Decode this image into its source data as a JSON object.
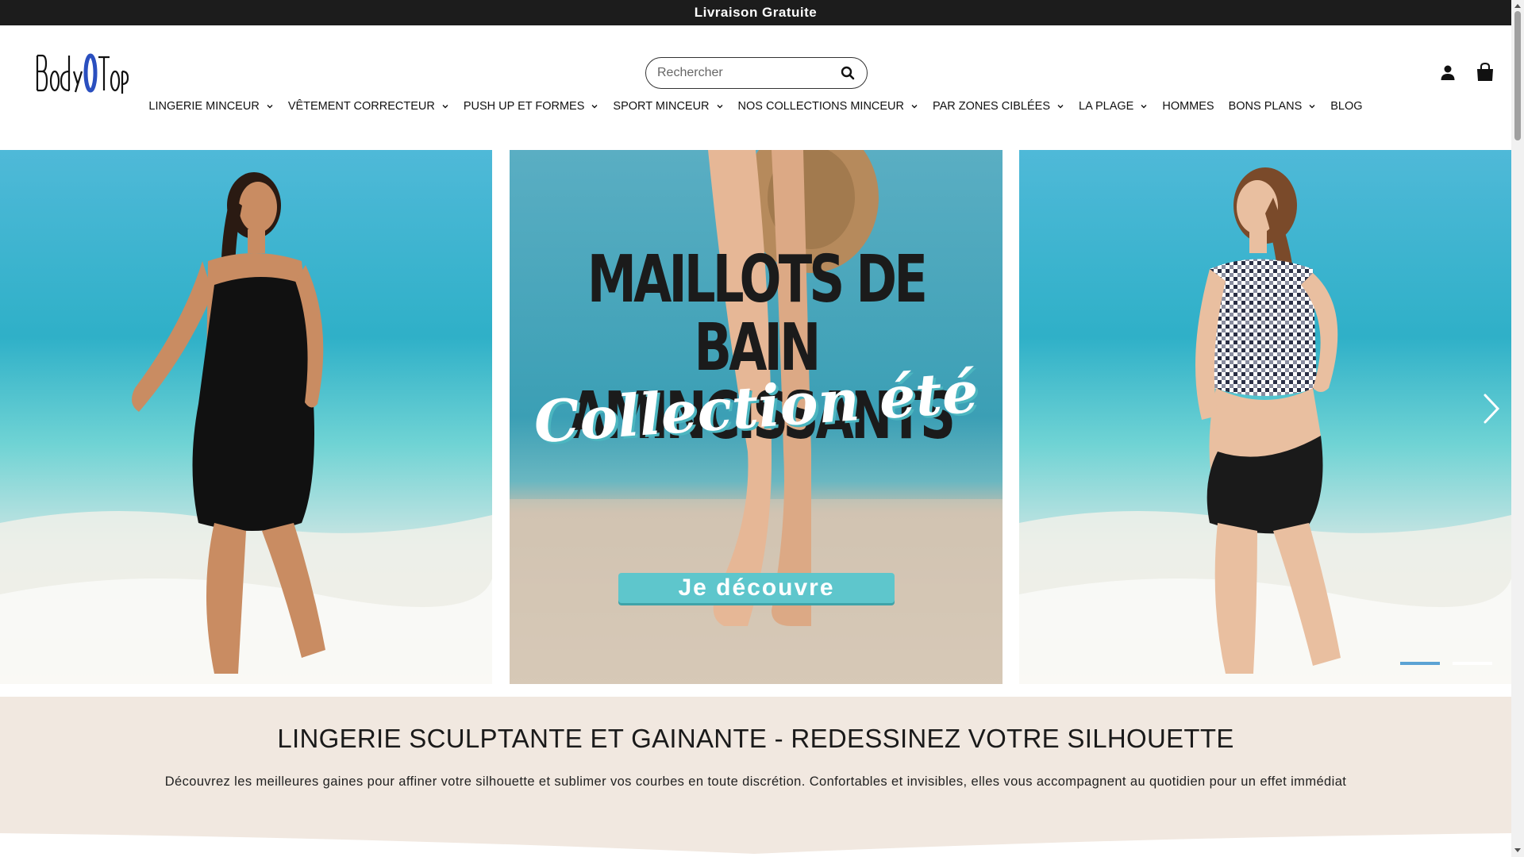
{
  "announcement": "Livraison Gratuite",
  "brand": "BodyOTop",
  "search": {
    "placeholder": "Rechercher"
  },
  "nav": [
    {
      "label": "LINGERIE MINCEUR",
      "dropdown": true
    },
    {
      "label": "VÊTEMENT CORRECTEUR",
      "dropdown": true
    },
    {
      "label": "PUSH UP ET FORMES",
      "dropdown": true
    },
    {
      "label": "SPORT MINCEUR",
      "dropdown": true
    },
    {
      "label": "NOS COLLECTIONS MINCEUR",
      "dropdown": true
    },
    {
      "label": "PAR ZONES CIBLÉES",
      "dropdown": true
    },
    {
      "label": "LA PLAGE",
      "dropdown": true
    },
    {
      "label": "HOMMES",
      "dropdown": false
    },
    {
      "label": "BONS PLANS",
      "dropdown": true
    },
    {
      "label": "BLOG",
      "dropdown": false
    }
  ],
  "hero": {
    "headline_line1": "MAILLOTS DE BAIN",
    "headline_line2": "AMINCISSANTS",
    "script": "Collection été",
    "cta": "Je découvre",
    "slides_total": 2,
    "active_slide": 1
  },
  "intro": {
    "title": "LINGERIE SCULPTANTE ET GAINANTE - REDESSINEZ VOTRE SILHOUETTE",
    "text": "Découvrez les meilleures gaines pour affiner votre silhouette et sublimer vos courbes en toute discrétion. Confortables et invisibles, elles vous accompagnent au quotidien pour un effet immédiat"
  },
  "colors": {
    "announcement_bg": "#1c1c1c",
    "intro_bg": "#f1e8e0",
    "cta_bg": "#5ec6cc",
    "dot_active": "#5ba3d4"
  },
  "icons": [
    "search-icon",
    "user-icon",
    "cart-icon",
    "chevron-down-icon",
    "chevron-right-icon"
  ]
}
